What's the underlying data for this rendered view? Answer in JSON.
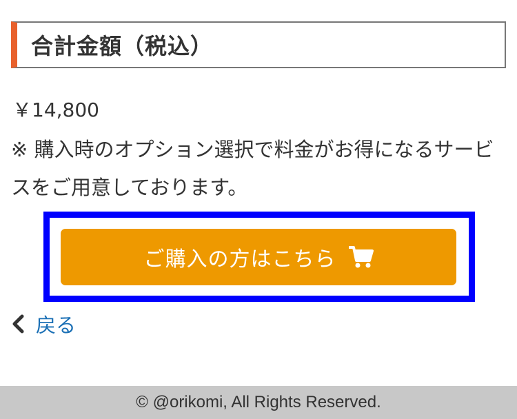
{
  "section": {
    "heading": "合計金額（税込）"
  },
  "price": "￥14,800",
  "note": "※ 購入時のオプション選択で料金がお得になるサービスをご用意しております。",
  "buy_button": {
    "label": "ご購入の方はこちら",
    "icon": "shopping-cart-icon"
  },
  "back_link": {
    "label": "戻る",
    "icon": "chevron-left-icon"
  },
  "footer": {
    "copyright": "© @orikomi, All Rights Reserved."
  },
  "colors": {
    "accent_bar": "#e8612c",
    "button": "#ee9900",
    "highlight_frame": "#0000ff",
    "link": "#1a6fb5",
    "footer_bg": "#c8c8c8"
  }
}
